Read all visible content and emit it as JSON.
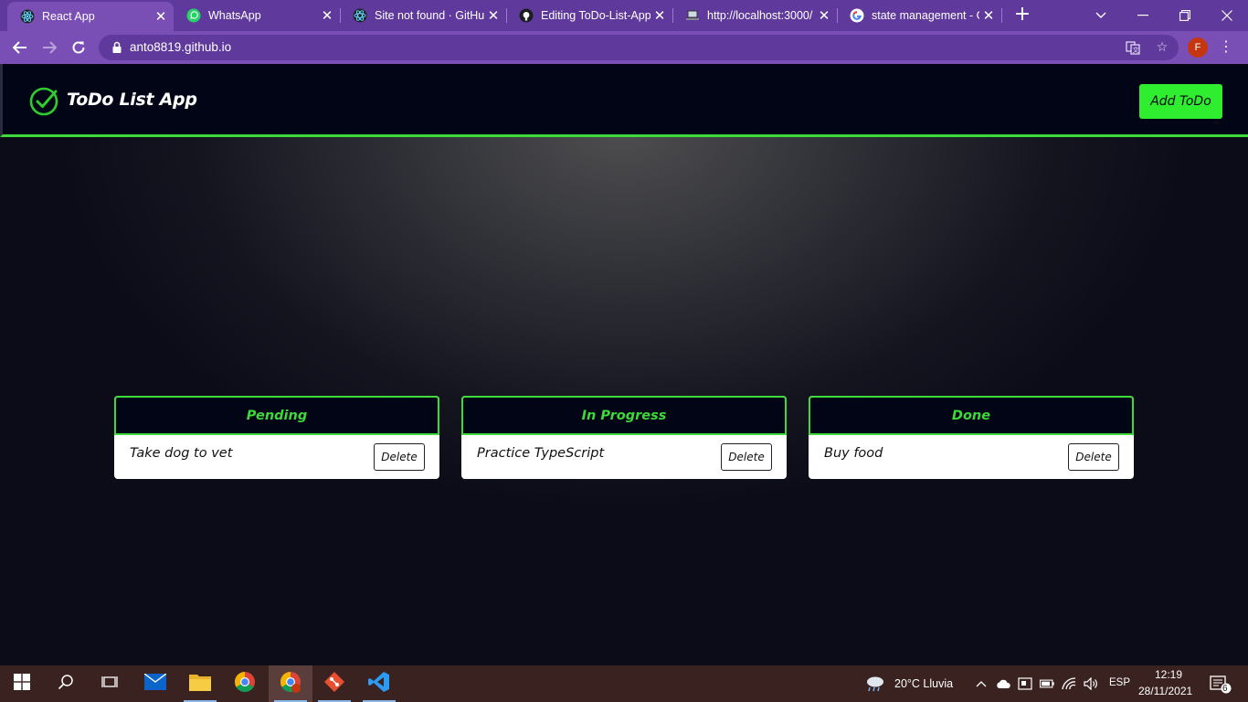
{
  "browser": {
    "tabs": [
      {
        "title": "React App",
        "icon": "react-icon",
        "active": true
      },
      {
        "title": "WhatsApp",
        "icon": "whatsapp-icon",
        "active": false
      },
      {
        "title": "Site not found · GitHu",
        "icon": "react-icon",
        "active": false
      },
      {
        "title": "Editing ToDo-List-App",
        "icon": "github-icon",
        "active": false
      },
      {
        "title": "http://localhost:3000/",
        "icon": "laptop-icon",
        "active": false
      },
      {
        "title": "state management - G",
        "icon": "google-icon",
        "active": false
      }
    ],
    "url": "anto8819.github.io",
    "profile_initial": "F",
    "theme_color": "#7a4fb5"
  },
  "app": {
    "title": "ToDo List App",
    "add_button": "Add ToDo",
    "accent_color": "#3ed93a",
    "columns": [
      {
        "title": "Pending",
        "tasks": [
          {
            "text": "Take dog to vet",
            "delete_label": "Delete"
          }
        ]
      },
      {
        "title": "In Progress",
        "tasks": [
          {
            "text": "Practice TypeScript",
            "delete_label": "Delete"
          }
        ]
      },
      {
        "title": "Done",
        "tasks": [
          {
            "text": "Buy food",
            "delete_label": "Delete"
          }
        ]
      }
    ]
  },
  "taskbar": {
    "weather": "20°C  Lluvia",
    "language": "ESP",
    "time": "12:19",
    "date": "28/11/2021",
    "notifications": "6"
  }
}
